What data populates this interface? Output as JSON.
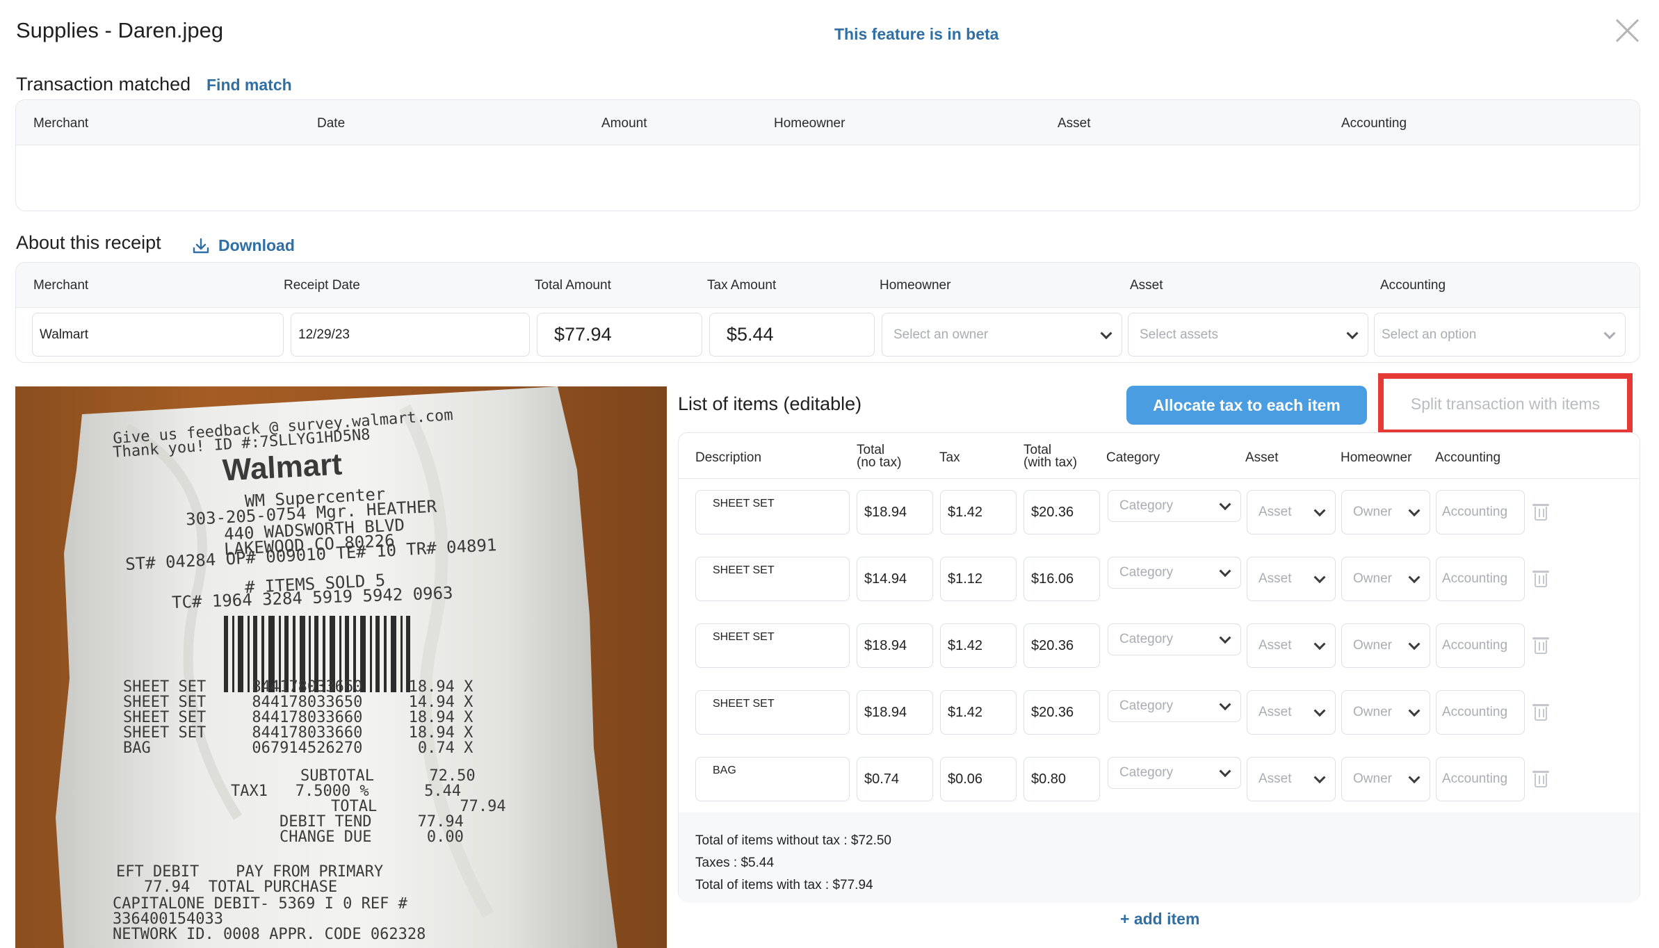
{
  "header": {
    "title": "Supplies - Daren.jpeg",
    "beta": "This feature is in beta"
  },
  "matched": {
    "title": "Transaction matched",
    "link": "Find match",
    "columns": [
      "Merchant",
      "Date",
      "Amount",
      "Homeowner",
      "Asset",
      "Accounting"
    ]
  },
  "about": {
    "title": "About this receipt",
    "download": "Download",
    "columns": [
      "Merchant",
      "Receipt Date",
      "Total Amount",
      "Tax Amount",
      "Homeowner",
      "Asset",
      "Accounting"
    ],
    "merchant": "Walmart",
    "date": "12/29/23",
    "total": "$77.94",
    "tax": "$5.44",
    "homeowner_placeholder": "Select an owner",
    "asset_placeholder": "Select assets",
    "accounting_placeholder": "Select an option"
  },
  "receipt": {
    "lines": [
      "Give us feedback @ survey.walmart.com",
      "Thank you! ID #:7SLLYG1HD5N8",
      "Walmart",
      "WM Supercenter",
      "303-205-0754 Mgr. HEATHER",
      "440 WADSWORTH BLVD",
      "LAKEWOOD CO 80226",
      "ST# 04284 OP# 009010 TE# 10 TR# 04891",
      "# ITEMS SOLD 5",
      "TC# 1964 3284 5919 5942 0963",
      "SHEET SET     844178033660     18.94 X",
      "SHEET SET     844178033650     14.94 X",
      "SHEET SET     844178033660     18.94 X",
      "SHEET SET     844178033660     18.94 X",
      "BAG           067914526270      0.74 X",
      "SUBTOTAL      72.50",
      "TAX1   7.5000 %      5.44",
      "TOTAL         77.94",
      "DEBIT TEND     77.94",
      "CHANGE DUE      0.00",
      "EFT DEBIT    PAY FROM PRIMARY",
      "77.94  TOTAL PURCHASE",
      "CAPITALONE DEBIT- 5369 I 0 REF #",
      "336400154033",
      "NETWORK ID. 0008 APPR. CODE 062328"
    ]
  },
  "items": {
    "title": "List of items (editable)",
    "allocate_button": "Allocate tax to each item",
    "split_button": "Split transaction with items",
    "columns": {
      "description": "Description",
      "total_no_tax_1": "Total",
      "total_no_tax_2": "(no tax)",
      "tax": "Tax",
      "total_with_tax_1": "Total",
      "total_with_tax_2": "(with tax)",
      "category": "Category",
      "asset": "Asset",
      "homeowner": "Homeowner",
      "accounting": "Accounting"
    },
    "placeholders": {
      "category": "Category",
      "asset": "Asset",
      "owner": "Owner",
      "accounting": "Accounting"
    },
    "rows": [
      {
        "description": "SHEET SET",
        "total": "$18.94",
        "tax": "$1.42",
        "total_with_tax": "$20.36"
      },
      {
        "description": "SHEET SET",
        "total": "$14.94",
        "tax": "$1.12",
        "total_with_tax": "$16.06"
      },
      {
        "description": "SHEET SET",
        "total": "$18.94",
        "tax": "$1.42",
        "total_with_tax": "$20.36"
      },
      {
        "description": "SHEET SET",
        "total": "$18.94",
        "tax": "$1.42",
        "total_with_tax": "$20.36"
      },
      {
        "description": "BAG",
        "total": "$0.74",
        "tax": "$0.06",
        "total_with_tax": "$0.80"
      }
    ],
    "totals": {
      "without_tax": "Total of items without tax : $72.50",
      "taxes": "Taxes : $5.44",
      "with_tax": "Total of items with tax : $77.94"
    },
    "add_item": "+ add item"
  }
}
